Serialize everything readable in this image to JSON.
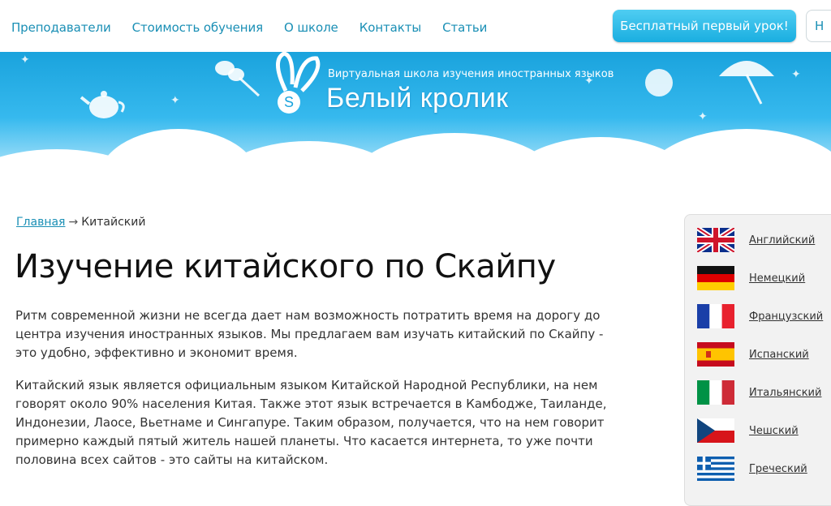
{
  "nav": {
    "items": [
      "Преподаватели",
      "Стоимость обучения",
      "О школе",
      "Контакты",
      "Статьи"
    ],
    "cta": "Бесплатный первый урок!",
    "cta_secondary": "Н"
  },
  "logo": {
    "subtitle": "Виртуальная школа изучения иностранных языков",
    "title": "Белый кролик"
  },
  "breadcrumb": {
    "home": "Главная",
    "separator": "→",
    "current": "Китайский"
  },
  "main": {
    "title": "Изучение китайского по Скайпу",
    "paragraphs": [
      "Ритм современной жизни не всегда дает нам возможность потратить время на дорогу до центра изучения иностранных языков. Мы предлагаем вам изучать китайский по Скайпу - это удобно, эффективно и экономит время.",
      "Китайский язык является официальным языком Китайской Народной Республики, на нем говорят около 90% населения Китая. Также этот язык встречается в Камбодже, Таиланде, Индонезии, Лаосе, Вьетнаме и Сингапуре. Таким образом, получается, что на нем говорит примерно каждый пятый житель нашей планеты. Что касается интернета, то уже почти половина всех сайтов - это сайты на китайском."
    ]
  },
  "languages": [
    {
      "label": "Английский",
      "flag": "uk-flag-icon"
    },
    {
      "label": "Немецкий",
      "flag": "germany-flag-icon"
    },
    {
      "label": "Французский",
      "flag": "france-flag-icon"
    },
    {
      "label": "Испанский",
      "flag": "spain-flag-icon"
    },
    {
      "label": "Итальянский",
      "flag": "italy-flag-icon"
    },
    {
      "label": "Чешский",
      "flag": "czech-flag-icon"
    },
    {
      "label": "Греческий",
      "flag": "greece-flag-icon"
    }
  ],
  "colors": {
    "link": "#1a8fb5",
    "accent": "#1aaee0",
    "banner": "#1aa3dd"
  }
}
